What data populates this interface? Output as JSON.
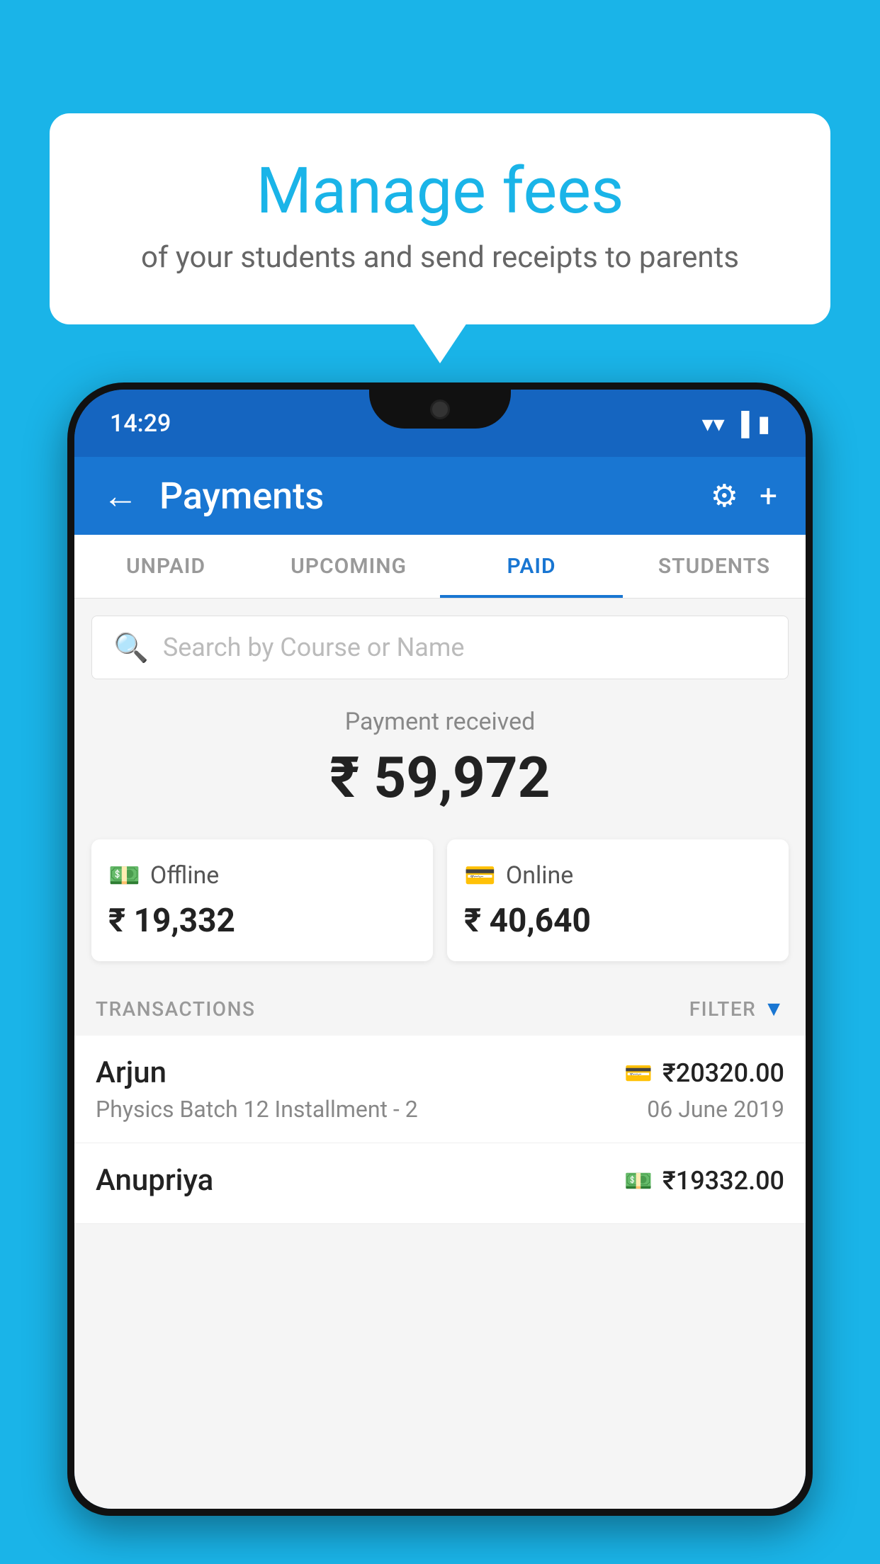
{
  "background_color": "#1ab4e8",
  "speech_bubble": {
    "title": "Manage fees",
    "subtitle": "of your students and send receipts to parents"
  },
  "phone": {
    "status_bar": {
      "time": "14:29"
    },
    "header": {
      "title": "Payments",
      "back_label": "←",
      "settings_label": "⚙",
      "add_label": "+"
    },
    "tabs": [
      {
        "label": "UNPAID",
        "active": false
      },
      {
        "label": "UPCOMING",
        "active": false
      },
      {
        "label": "PAID",
        "active": true
      },
      {
        "label": "STUDENTS",
        "active": false
      }
    ],
    "search": {
      "placeholder": "Search by Course or Name"
    },
    "payment_summary": {
      "label": "Payment received",
      "amount": "₹ 59,972",
      "offline_label": "Offline",
      "offline_amount": "₹ 19,332",
      "online_label": "Online",
      "online_amount": "₹ 40,640"
    },
    "transactions": {
      "header_label": "TRANSACTIONS",
      "filter_label": "FILTER",
      "items": [
        {
          "name": "Arjun",
          "amount": "₹20320.00",
          "course": "Physics Batch 12 Installment - 2",
          "date": "06 June 2019",
          "payment_type": "online"
        },
        {
          "name": "Anupriya",
          "amount": "₹19332.00",
          "course": "",
          "date": "",
          "payment_type": "offline"
        }
      ]
    }
  }
}
